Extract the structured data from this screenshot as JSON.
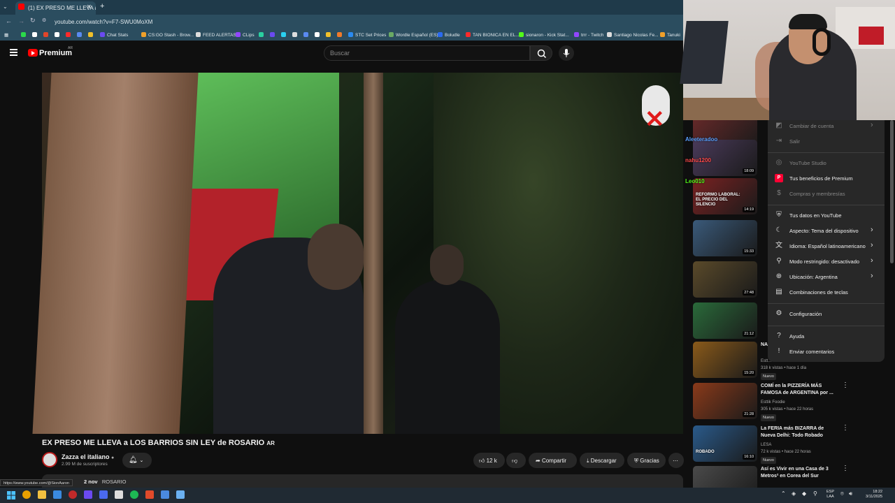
{
  "browser": {
    "tab_title": "(1) EX PRESO ME LLEVA a LOS B",
    "url": "youtube.com/watch?v=F7-SWU0MoXM",
    "bookmarks": [
      "Chat Stats",
      "CS:GO Stash - Brow...",
      "FEED ALERTAS",
      "CLips",
      "STC Set Prices",
      "Wordle Español (ES)",
      "Boludle",
      "TAN BIONICA EN EL...",
      "sionaron - Kick Stat...",
      "trrr - Twitch",
      "Santiago Nicolas Fe...",
      "Tanuki"
    ]
  },
  "header": {
    "logo_text": "Premium",
    "region": "AR",
    "search_placeholder": "Buscar"
  },
  "video": {
    "title": "EX PRESO ME LLEVA a LOS BARRIOS SIN LEY de ROSARIO",
    "title_suffix": "AR",
    "channel_name": "Zazza el italiano",
    "subscribers": "2.99 M de suscriptores",
    "likes": "12 k",
    "share_label": "Compartir",
    "download_label": "Descargar",
    "thanks_label": "Gracias",
    "desc_prefix": "2 nov",
    "desc_tag": "ROSARIO",
    "status_url": "https://www.youtube.com/@SionAaron"
  },
  "chat_overlay": [
    {
      "name": "Aleeteradoo"
    },
    {
      "name": "nahu1200"
    },
    {
      "name": "Leo010"
    }
  ],
  "menu": {
    "items": [
      {
        "icon": "switch-account-icon",
        "glyph": "◩",
        "label": "Cambiar de cuenta",
        "chevron": true,
        "dim": true
      },
      {
        "icon": "sign-out-icon",
        "glyph": "⇥",
        "label": "Salir",
        "chevron": false,
        "dim": true
      },
      {
        "icon": "youtube-studio-icon",
        "glyph": "◎",
        "label": "YouTube Studio",
        "chevron": false,
        "dim": true
      },
      {
        "icon": "premium-benefits-icon",
        "glyph": "P",
        "label": "Tus beneficios de Premium",
        "chevron": false,
        "dim": false
      },
      {
        "icon": "purchases-icon",
        "glyph": "$",
        "label": "Compras y membresías",
        "chevron": false,
        "dim": true
      },
      {
        "icon": "your-data-icon",
        "glyph": "⛨",
        "label": "Tus datos en YouTube",
        "chevron": false,
        "dim": false
      },
      {
        "icon": "appearance-icon",
        "glyph": "☾",
        "label": "Aspecto: Tema del dispositivo",
        "chevron": true,
        "dim": false
      },
      {
        "icon": "language-icon",
        "glyph": "文",
        "label": "Idioma: Español latinoamericano",
        "chevron": true,
        "dim": false
      },
      {
        "icon": "restricted-mode-icon",
        "glyph": "⚲",
        "label": "Modo restringido: desactivado",
        "chevron": true,
        "dim": false
      },
      {
        "icon": "location-icon",
        "glyph": "⊕",
        "label": "Ubicación: Argentina",
        "chevron": true,
        "dim": false
      },
      {
        "icon": "keyboard-icon",
        "glyph": "▤",
        "label": "Combinaciones de teclas",
        "chevron": false,
        "dim": false
      },
      {
        "icon": "settings-icon",
        "glyph": "⚙",
        "label": "Configuración",
        "chevron": false,
        "dim": false
      },
      {
        "icon": "help-icon",
        "glyph": "?",
        "label": "Ayuda",
        "chevron": false,
        "dim": false
      },
      {
        "icon": "feedback-icon",
        "glyph": "!",
        "label": "Enviar comentarios",
        "chevron": false,
        "dim": false
      }
    ]
  },
  "recommendations": [
    {
      "duration": "21:07",
      "color": "#6a2a2a"
    },
    {
      "duration": "18:09",
      "color": "#4a3a5a"
    },
    {
      "duration": "14:19",
      "color": "#7a2222",
      "thumb_text": "REFORMO LABORAL: EL PRECIO DEL SILENCIO"
    },
    {
      "duration": "15:33",
      "color": "#3a5a7a"
    },
    {
      "duration": "27:48",
      "color": "#5a4a2a"
    },
    {
      "duration": "21:12",
      "color": "#2a6a3a"
    },
    {
      "duration": "15:20",
      "color": "#8a5a1a",
      "title": "NA... RE...",
      "meta1": "Estt...",
      "meta2": "318 k vistas • hace 1 día",
      "nuevo": "Nuevo"
    },
    {
      "duration": "21:28",
      "color": "#8a3a1a",
      "title": "COMÍ en la PIZZERÍA MÁS FAMOSA de ARGENTINA por ...",
      "meta1": "Esttik Foodie",
      "meta2": "305 k vistas • hace 22 horas",
      "nuevo": "Nuevo"
    },
    {
      "duration": "16:10",
      "color": "#2a5a8a",
      "thumb_text": "ROBADO",
      "title": "La FERIA más BIZARRA de Nueva Delhi: Todo Robado",
      "meta1": "LESA",
      "meta2": "72 k vistas • hace 22 horas",
      "nuevo": "Nuevo"
    },
    {
      "duration": "",
      "color": "#4a4a4a",
      "thumb_text": "3m²",
      "title": "Así es Vivir en una Casa de 3 Metros² en Corea del Sur",
      "meta1": "",
      "meta2": "",
      "nuevo": ""
    }
  ],
  "taskbar": {
    "lang": "ESP",
    "lang2": "LAA",
    "time": "18:22",
    "date": "3/11/2025"
  }
}
